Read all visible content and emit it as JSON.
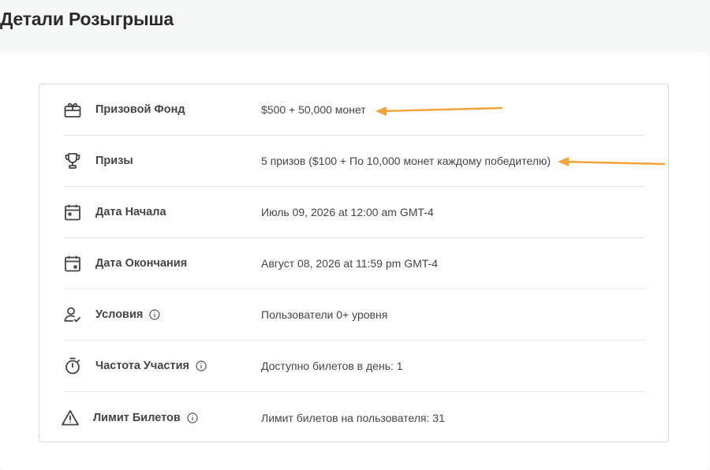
{
  "page": {
    "title": "Детали Розыгрыша"
  },
  "details": [
    {
      "icon": "gift-box-icon",
      "label": "Призовой Фонд",
      "value": "$500 + 50,000 монет",
      "info": false
    },
    {
      "icon": "trophy-icon",
      "label": "Призы",
      "value": "5 призов ($100 + По 10,000 монет каждому победителю)",
      "info": false
    },
    {
      "icon": "calendar-start-icon",
      "label": "Дата Начала",
      "value": "Июль 09, 2026 at 12:00 am GMT-4",
      "info": false
    },
    {
      "icon": "calendar-end-icon",
      "label": "Дата Окончания",
      "value": "Август 08, 2026 at 11:59 pm GMT-4",
      "info": false
    },
    {
      "icon": "user-check-icon",
      "label": "Условия",
      "value": "Пользователи 0+ уровня",
      "info": true
    },
    {
      "icon": "stopwatch-icon",
      "label": "Частота Участия",
      "value": "Доступно билетов в день: 1",
      "info": true
    },
    {
      "icon": "warning-triangle-icon",
      "label": "Лимит Билетов",
      "value": "Лимит билетов на пользователя: 31",
      "info": true
    }
  ],
  "annotations": {
    "arrow_color": "#f5a23a"
  }
}
